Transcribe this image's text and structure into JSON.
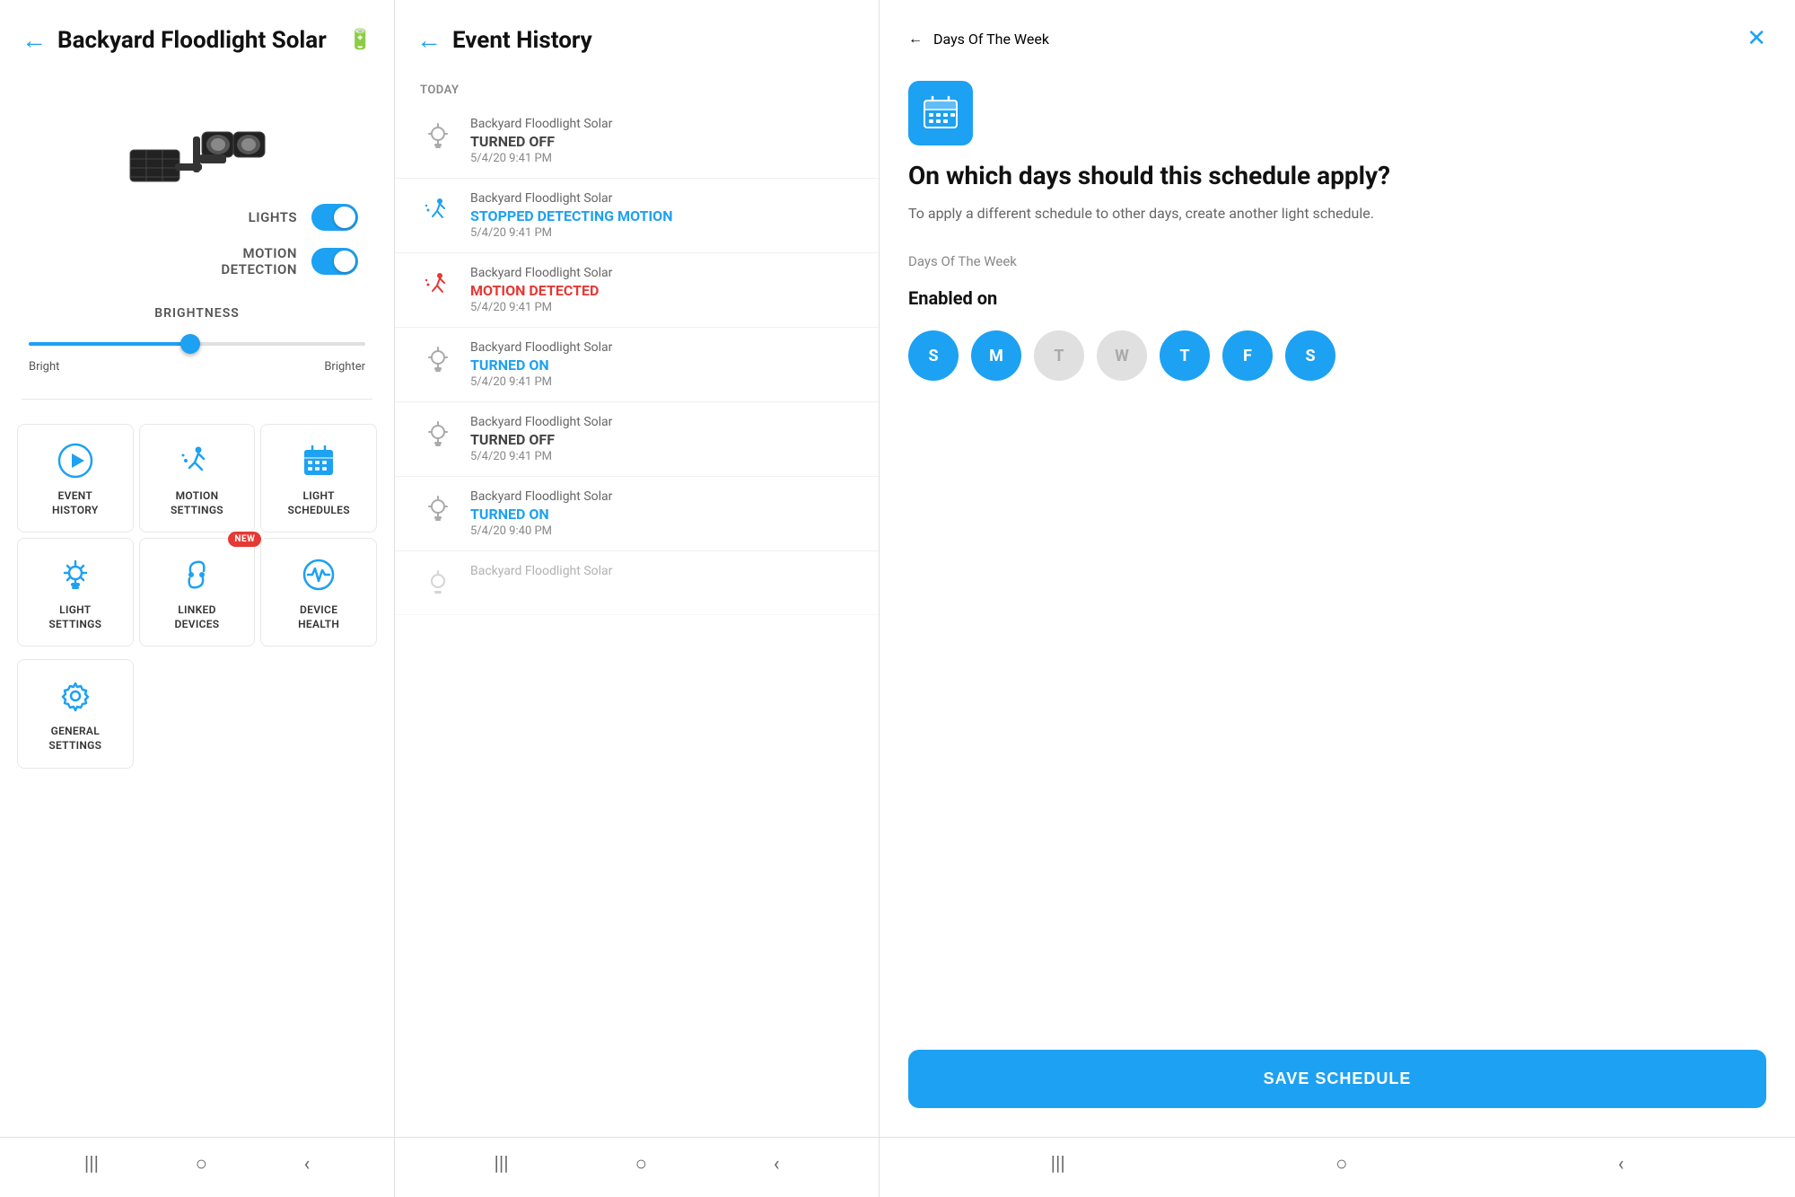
{
  "panel1": {
    "title": "Backyard Floodlight Solar",
    "back_label": "←",
    "lights_label": "LIGHTS",
    "motion_label": "MOTION\nDETECTION",
    "brightness_label": "BRIGHTNESS",
    "bright_label": "Bright",
    "brighter_label": "Brighter",
    "menu_items": [
      {
        "id": "event-history",
        "label": "EVENT\nHISTORY",
        "icon": "▶"
      },
      {
        "id": "motion-settings",
        "label": "MOTION\nSETTINGS",
        "icon": "🏃"
      },
      {
        "id": "light-schedules",
        "label": "LIGHT\nSCHEDULES",
        "icon": "📅"
      },
      {
        "id": "light-settings",
        "label": "LIGHT\nSETTINGS",
        "icon": "💡"
      },
      {
        "id": "linked-devices",
        "label": "LINKED\nDEVICES",
        "icon": "🔗",
        "badge": "NEW"
      },
      {
        "id": "device-health",
        "label": "DEVICE\nHEALTH",
        "icon": "📈"
      }
    ],
    "bottom_menu": [
      {
        "id": "general-settings",
        "label": "GENERAL\nSETTINGS",
        "icon": "⚙"
      }
    ],
    "nav": [
      "|||",
      "○",
      "‹"
    ]
  },
  "panel2": {
    "title": "Event History",
    "back_label": "←",
    "section_today": "TODAY",
    "events": [
      {
        "device": "Backyard Floodlight Solar",
        "action": "TURNED OFF",
        "action_style": "gray",
        "time": "5/4/20 9:41 PM",
        "icon": "light-off"
      },
      {
        "device": "Backyard Floodlight Solar",
        "action": "STOPPED DETECTING MOTION",
        "action_style": "blue",
        "time": "5/4/20 9:41 PM",
        "icon": "motion-stop"
      },
      {
        "device": "Backyard Floodlight Solar",
        "action": "MOTION DETECTED",
        "action_style": "red",
        "time": "5/4/20 9:41 PM",
        "icon": "motion-detect"
      },
      {
        "device": "Backyard Floodlight Solar",
        "action": "TURNED ON",
        "action_style": "blue",
        "time": "5/4/20 9:41 PM",
        "icon": "light-on"
      },
      {
        "device": "Backyard Floodlight Solar",
        "action": "TURNED OFF",
        "action_style": "gray",
        "time": "5/4/20 9:41 PM",
        "icon": "light-off"
      },
      {
        "device": "Backyard Floodlight Solar",
        "action": "TURNED ON",
        "action_style": "blue",
        "time": "5/4/20 9:40 PM",
        "icon": "light-on"
      },
      {
        "device": "Backyard Floodlight Solar",
        "action": "",
        "action_style": "gray",
        "time": "",
        "icon": "light-on",
        "partial": true
      }
    ],
    "nav": [
      "|||",
      "○",
      "‹"
    ]
  },
  "panel3": {
    "title": "Days Of The Week",
    "back_label": "←",
    "close_label": "✕",
    "question": "On which days should this schedule apply?",
    "description": "To apply a different schedule to other days, create another light schedule.",
    "days_of_week_label": "Days Of The Week",
    "enabled_on_label": "Enabled on",
    "days": [
      {
        "letter": "S",
        "active": true
      },
      {
        "letter": "M",
        "active": true
      },
      {
        "letter": "T",
        "active": false
      },
      {
        "letter": "W",
        "active": false
      },
      {
        "letter": "T",
        "active": true
      },
      {
        "letter": "F",
        "active": true
      },
      {
        "letter": "S",
        "active": true
      }
    ],
    "save_button": "SAVE SCHEDULE",
    "nav": [
      "|||",
      "○",
      "‹"
    ]
  }
}
